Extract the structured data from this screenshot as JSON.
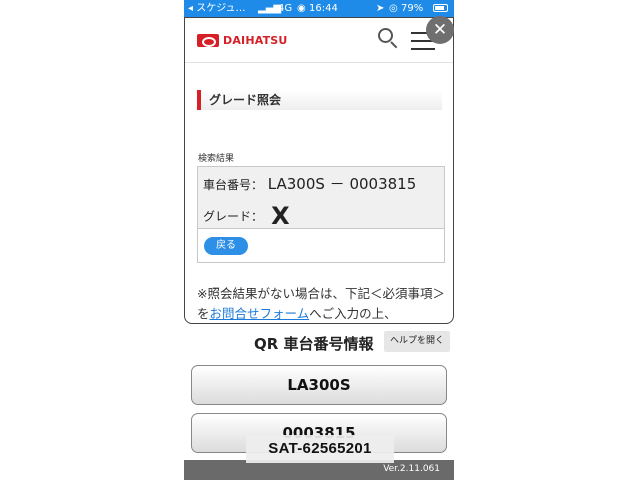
{
  "status_bar": {
    "carrier": "◂ スケジュ…",
    "network": "4G",
    "time": "16:44",
    "battery": "79%"
  },
  "modal": {
    "logo_text": "DAIHATSU",
    "section_title": "グレード照会",
    "result_label": "検索結果",
    "vehicle_number_label": "車台番号：",
    "vehicle_number_value": "LA300S － 0003815",
    "grade_label": "グレード：",
    "grade_value": "X",
    "back_button": "戻る",
    "note_part1": "※照会結果がない場合は、下記＜必須事項＞を",
    "note_link": "お問合せフォーム",
    "note_part2": "へご入力の上、"
  },
  "qr_section": {
    "title": "QR 車台番号情報",
    "help_button": "ヘルプを開く",
    "field1": "LA300S",
    "field2": "0003815"
  },
  "footer": {
    "version": "Ver.2.11.061"
  },
  "watermark": "SAT-62565201",
  "colors": {
    "brand_red": "#d61f26",
    "status_blue": "#1e8be8",
    "button_blue": "#2d8fe5",
    "link_blue": "#1d7ad8"
  }
}
